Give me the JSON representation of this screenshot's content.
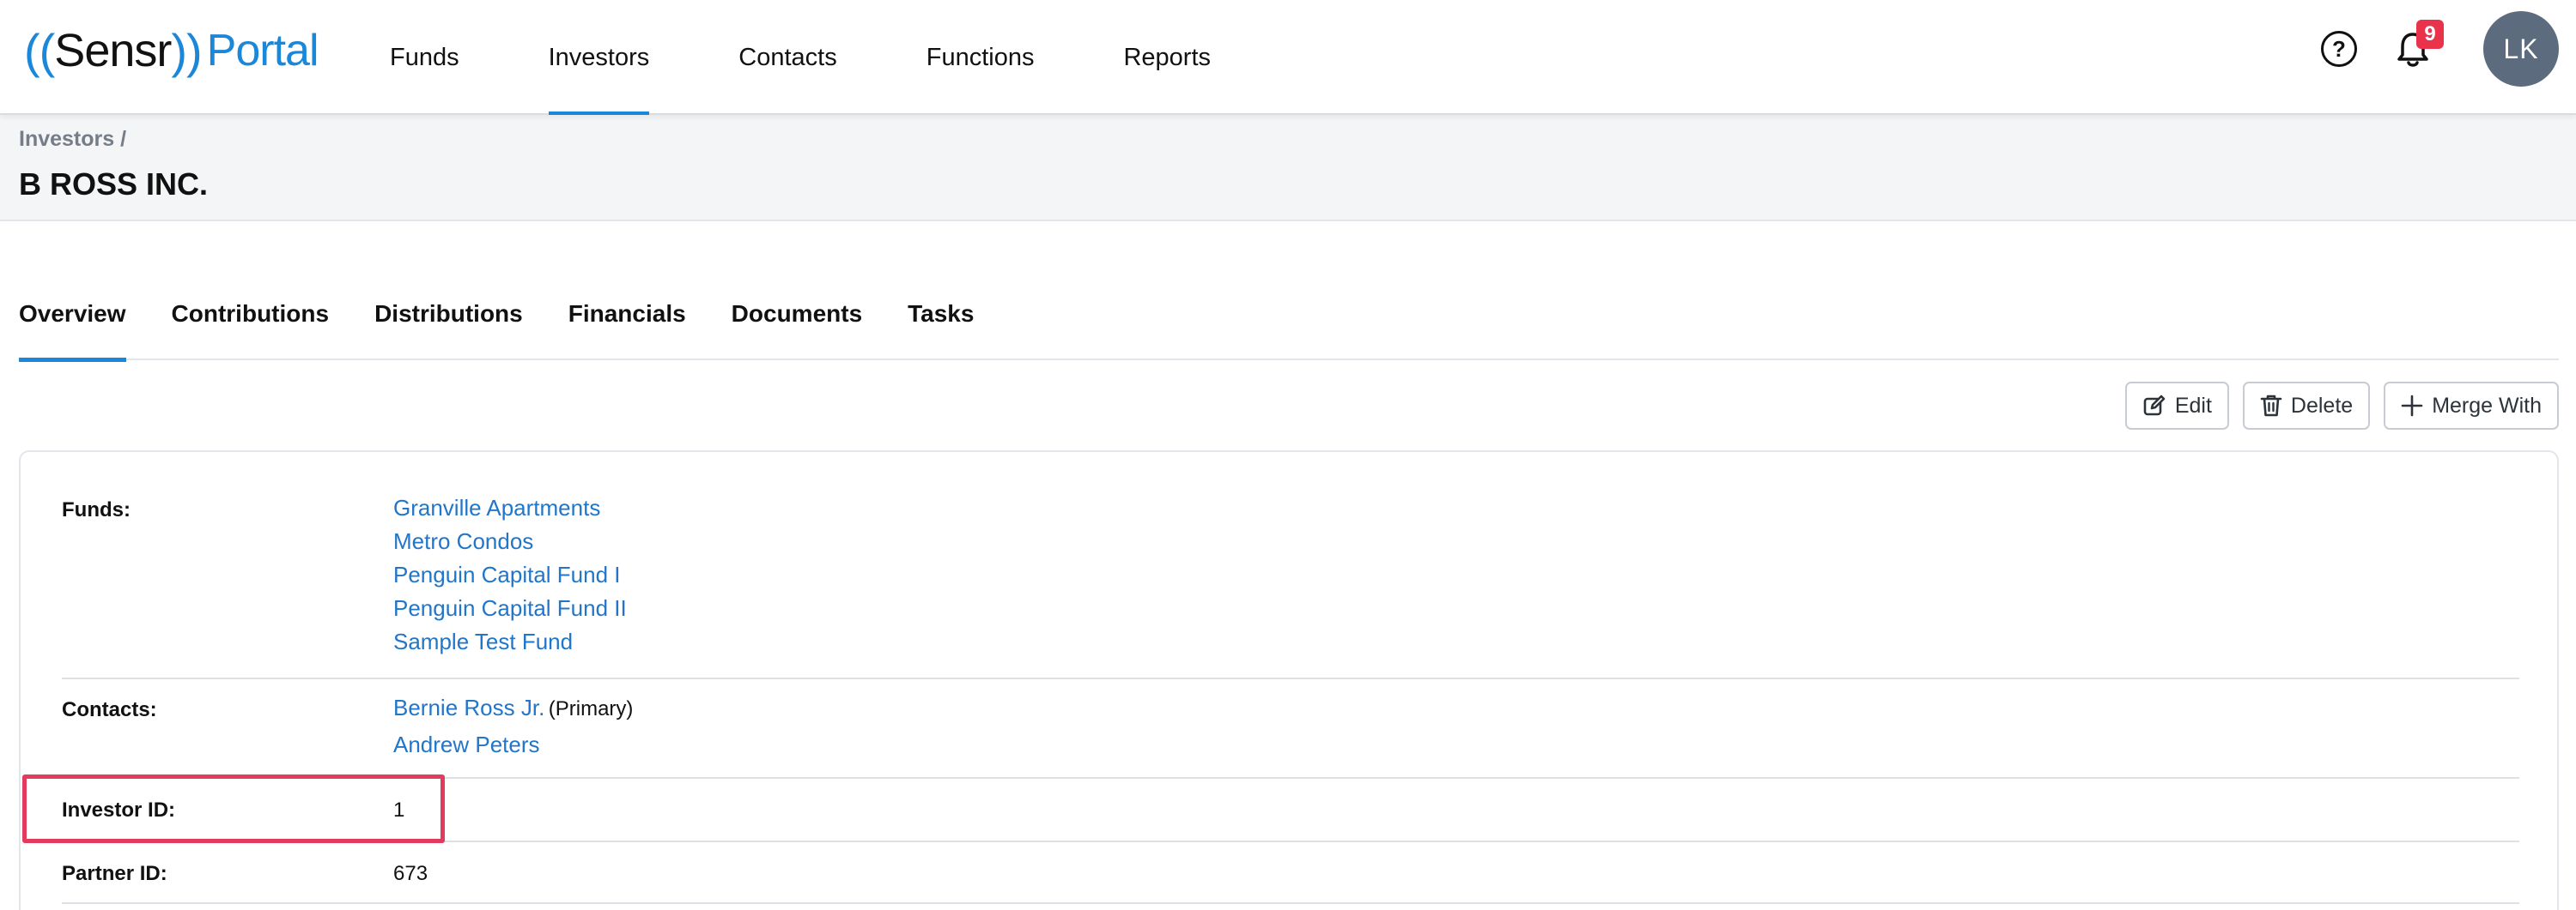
{
  "app": {
    "logo_left": "((",
    "logo_name": "Sensr",
    "logo_right": "))",
    "logo_portal": "Portal"
  },
  "nav": {
    "items": [
      {
        "label": "Funds"
      },
      {
        "label": "Investors"
      },
      {
        "label": "Contacts"
      },
      {
        "label": "Functions"
      },
      {
        "label": "Reports"
      }
    ],
    "active": "Investors",
    "notifications_count": "9",
    "avatar_initials": "LK"
  },
  "header": {
    "breadcrumb": "Investors /",
    "title": "B ROSS INC."
  },
  "tabs": [
    {
      "label": "Overview"
    },
    {
      "label": "Contributions"
    },
    {
      "label": "Distributions"
    },
    {
      "label": "Financials"
    },
    {
      "label": "Documents"
    },
    {
      "label": "Tasks"
    }
  ],
  "active_tab": "Overview",
  "actions": {
    "edit_label": "Edit",
    "delete_label": "Delete",
    "merge_label": "Merge With"
  },
  "details": {
    "funds_label": "Funds:",
    "funds": [
      "Granville Apartments",
      "Metro Condos",
      "Penguin Capital Fund I",
      "Penguin Capital Fund II",
      "Sample Test Fund"
    ],
    "contacts_label": "Contacts:",
    "contacts": [
      {
        "name": "Bernie Ross Jr.",
        "note": "(Primary)"
      },
      {
        "name": "Andrew Peters",
        "note": ""
      }
    ],
    "investor_id_label": "Investor ID:",
    "investor_id": "1",
    "partner_id_label": "Partner ID:",
    "partner_id": "673"
  },
  "colors": {
    "accent": "#1b87d8",
    "link": "#2176c9",
    "badge": "#e8334a",
    "highlight": "#e23b5d",
    "avatar": "#5d6b7e"
  }
}
